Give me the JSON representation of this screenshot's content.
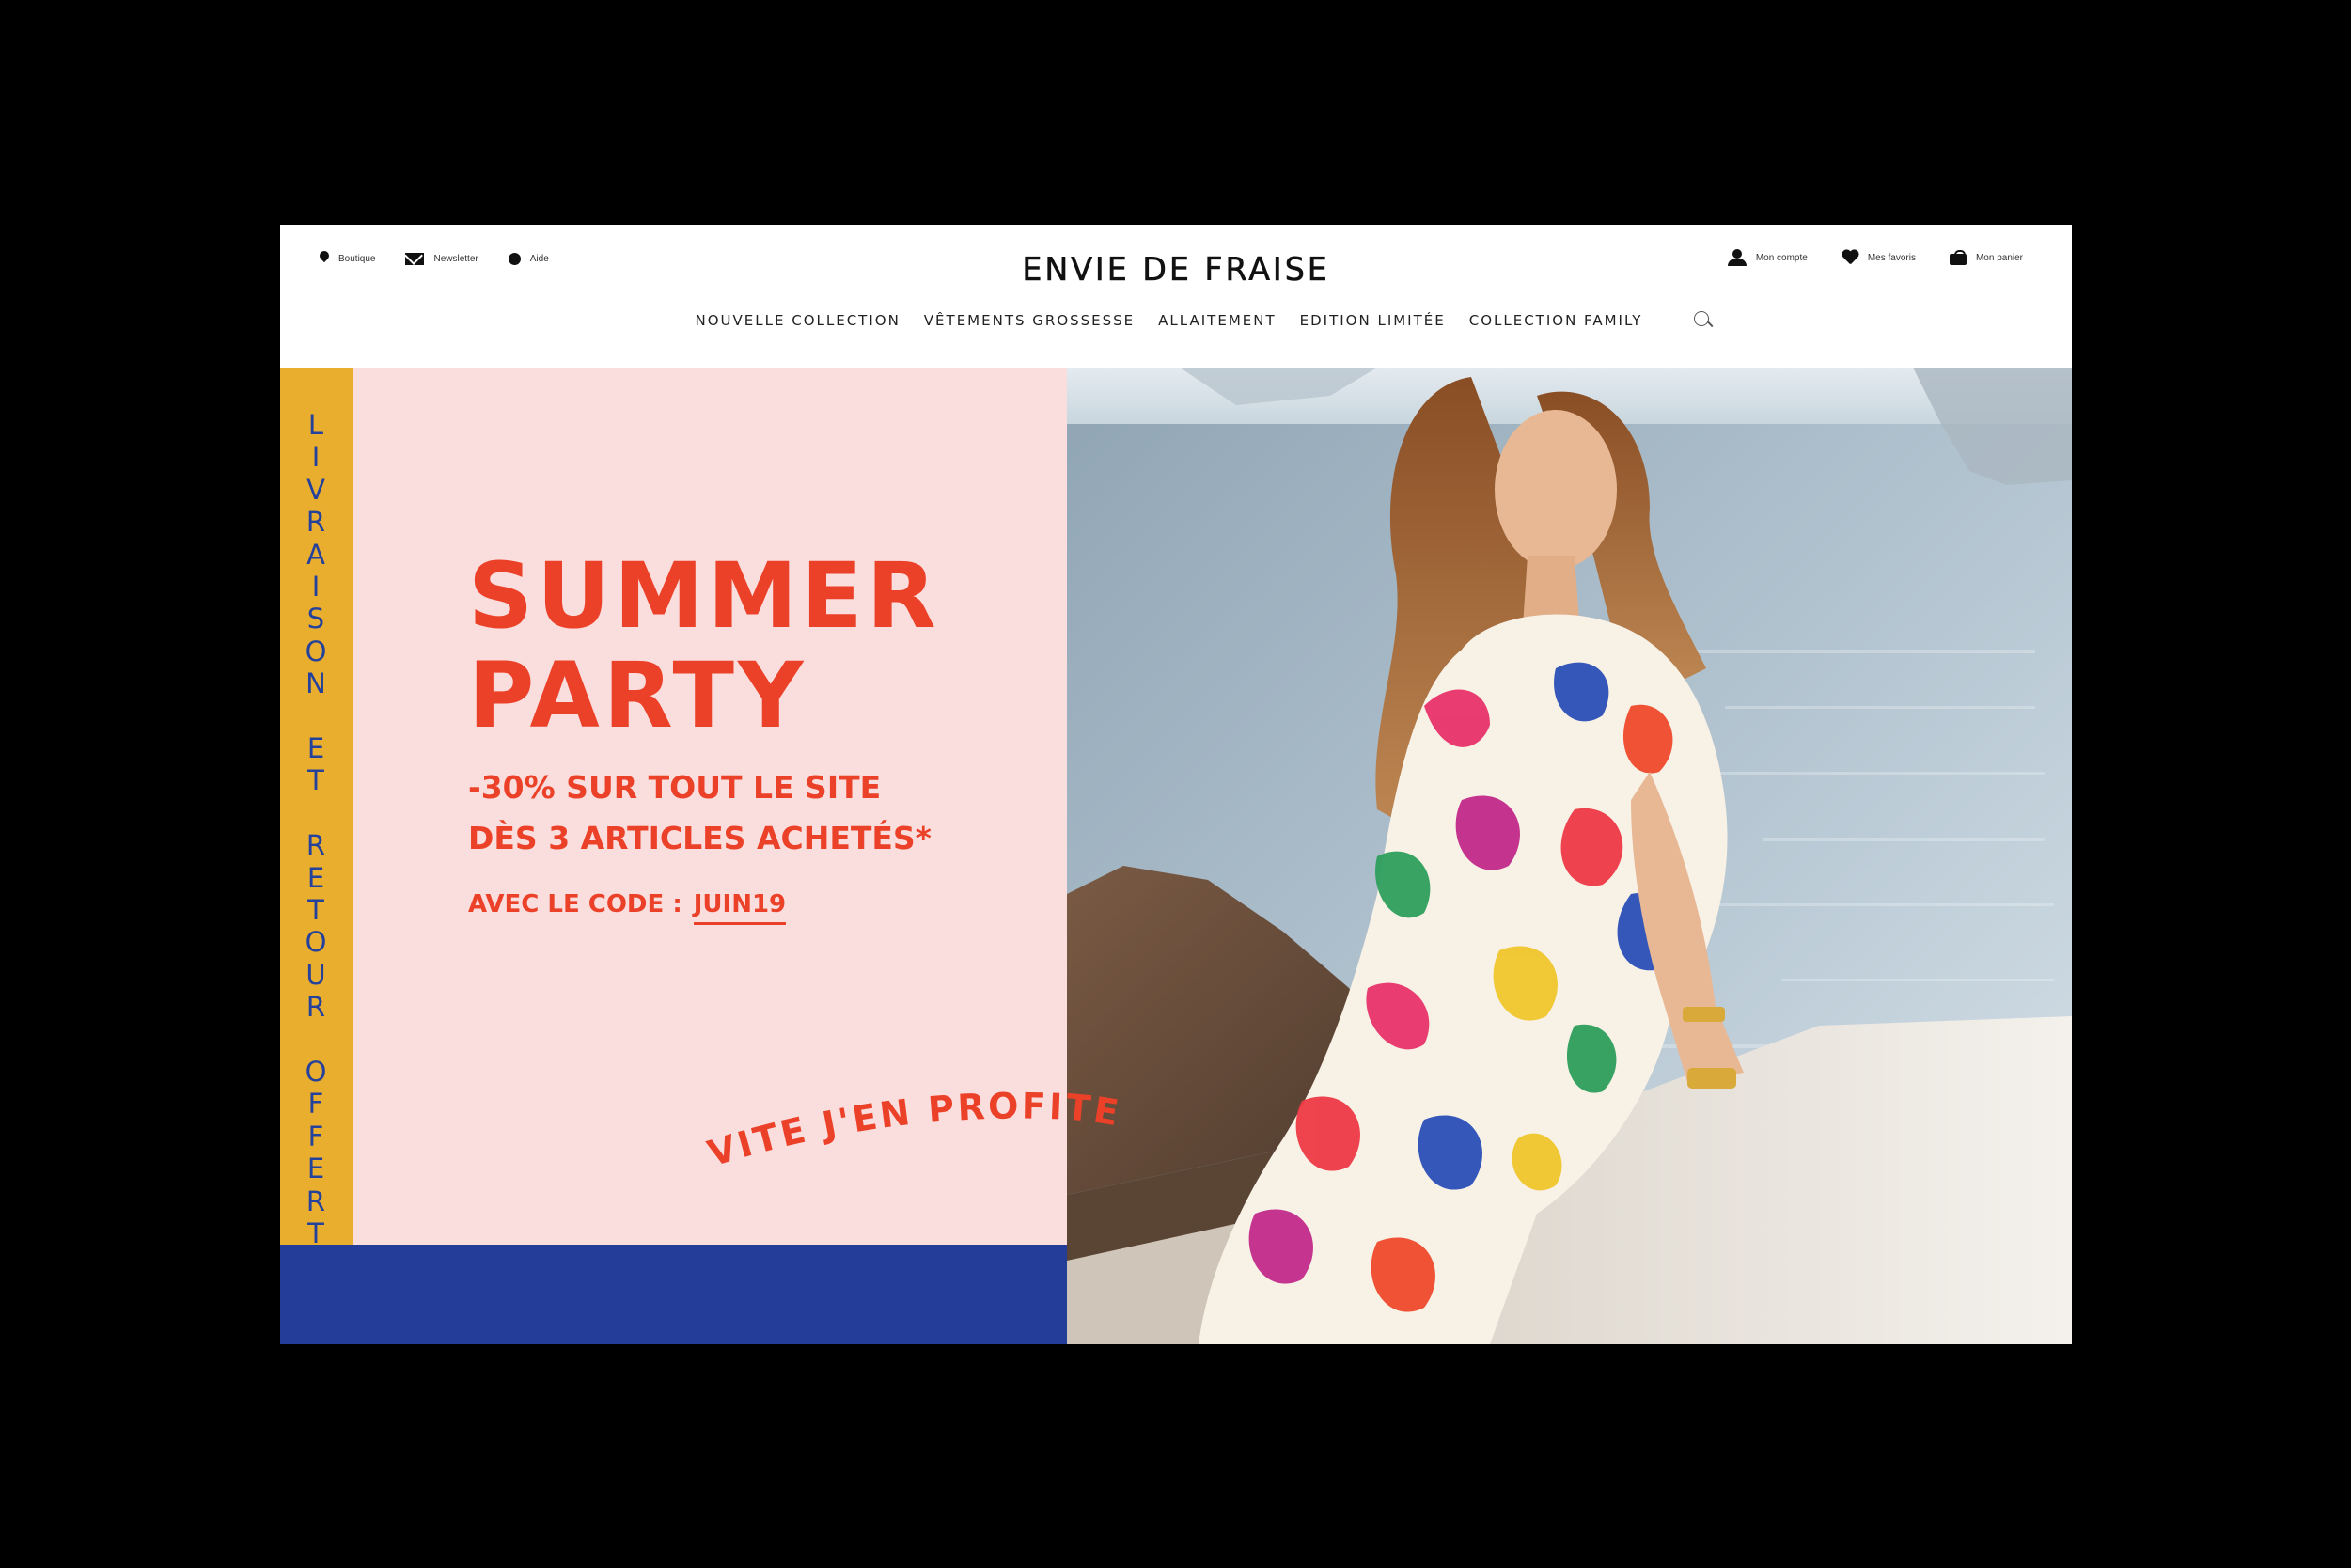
{
  "header": {
    "brand": "ENVIE DE FRAISE",
    "util_left": [
      {
        "label": "Boutique",
        "icon": "pin-icon"
      },
      {
        "label": "Newsletter",
        "icon": "mail-icon"
      },
      {
        "label": "Aide",
        "icon": "help-icon"
      }
    ],
    "util_right": [
      {
        "label": "Mon compte",
        "icon": "user-icon"
      },
      {
        "label": "Mes favoris",
        "icon": "heart-icon"
      },
      {
        "label": "Mon panier",
        "icon": "bag-icon"
      }
    ],
    "nav": [
      "NOUVELLE COLLECTION",
      "VÊTEMENTS GROSSESSE",
      "ALLAITEMENT",
      "EDITION LIMITÉE",
      "COLLECTION FAMILY"
    ]
  },
  "hero": {
    "side_banner": [
      "L",
      "I",
      "V",
      "R",
      "A",
      "I",
      "S",
      "O",
      "N",
      " ",
      "E",
      "T",
      " ",
      "R",
      "E",
      "T",
      "O",
      "U",
      "R",
      " ",
      "O",
      "F",
      "F",
      "E",
      "R",
      "T"
    ],
    "headline": [
      "SUMMER",
      "PARTY"
    ],
    "offer": [
      "-30% SUR TOUT LE SITE",
      "DÈS 3 ARTICLES ACHETÉS*"
    ],
    "code_prefix": "AVEC LE CODE :",
    "code": "JUIN19",
    "cta": "VITE J'EN PROFITE"
  },
  "colors": {
    "pink": "#fadddd",
    "yellow": "#e9ae2e",
    "blue": "#233d99",
    "red": "#ec4129"
  }
}
